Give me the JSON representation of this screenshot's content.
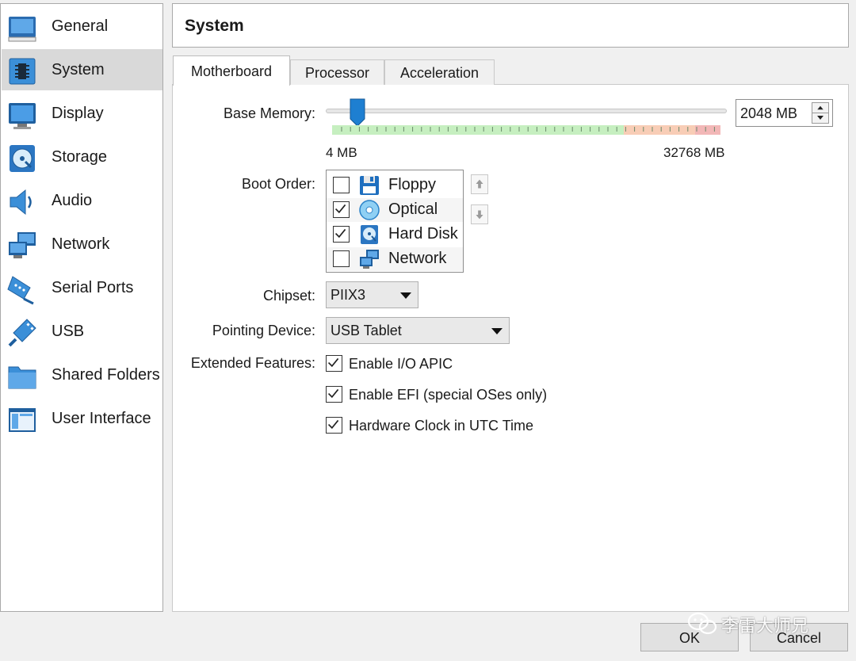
{
  "sidebar": {
    "items": [
      {
        "label": "General",
        "icon": "general-icon"
      },
      {
        "label": "System",
        "icon": "chip-icon",
        "selected": true
      },
      {
        "label": "Display",
        "icon": "monitor-icon"
      },
      {
        "label": "Storage",
        "icon": "disk-icon"
      },
      {
        "label": "Audio",
        "icon": "speaker-icon"
      },
      {
        "label": "Network",
        "icon": "network-icon"
      },
      {
        "label": "Serial Ports",
        "icon": "serial-port-icon"
      },
      {
        "label": "USB",
        "icon": "usb-icon"
      },
      {
        "label": "Shared Folders",
        "icon": "folder-icon"
      },
      {
        "label": "User Interface",
        "icon": "window-icon"
      }
    ]
  },
  "header": {
    "title": "System"
  },
  "tabs": [
    {
      "label": "Motherboard",
      "active": true
    },
    {
      "label": "Processor"
    },
    {
      "label": "Acceleration"
    }
  ],
  "motherboard": {
    "base_memory": {
      "label": "Base Memory:",
      "value": "2048 MB",
      "value_mb": 2048,
      "min_label": "4 MB",
      "max_label": "32768 MB"
    },
    "boot_order": {
      "label": "Boot Order:",
      "items": [
        {
          "label": "Floppy",
          "checked": false,
          "icon": "floppy-icon"
        },
        {
          "label": "Optical",
          "checked": true,
          "icon": "optical-disc-icon"
        },
        {
          "label": "Hard Disk",
          "checked": true,
          "icon": "hard-disk-icon"
        },
        {
          "label": "Network",
          "checked": false,
          "icon": "network-icon"
        }
      ]
    },
    "chipset": {
      "label": "Chipset:",
      "value": "PIIX3"
    },
    "pointing_device": {
      "label": "Pointing Device:",
      "value": "USB Tablet"
    },
    "extended_features": {
      "label": "Extended Features:",
      "items": [
        {
          "label": "Enable I/O APIC",
          "checked": true
        },
        {
          "label": "Enable EFI (special OSes only)",
          "checked": true
        },
        {
          "label": "Hardware Clock in UTC Time",
          "checked": true
        }
      ]
    }
  },
  "buttons": {
    "ok": "OK",
    "cancel": "Cancel"
  },
  "watermark": {
    "text": "李雷大师兄",
    "icon": "wechat-icon"
  },
  "colors": {
    "accent": "#1e7fd1",
    "selected_bg": "#d9d9d9",
    "scale_green": "#c6efc0",
    "scale_orange": "#f8cdb6",
    "scale_red": "#f2b7b7"
  }
}
